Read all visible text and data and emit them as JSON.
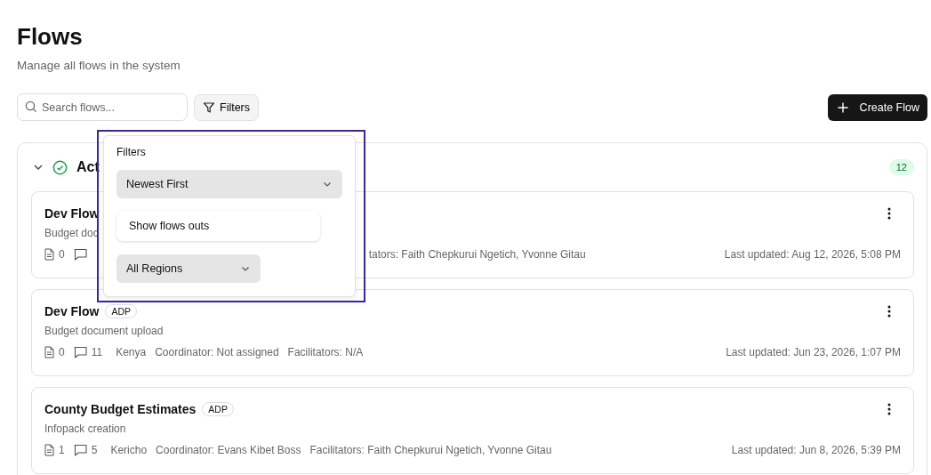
{
  "page": {
    "title": "Flows",
    "subtitle": "Manage all flows in the system"
  },
  "toolbar": {
    "search": {
      "placeholder": "Search flows..."
    },
    "filters_button": "Filters",
    "create_button": "Create Flow"
  },
  "filters_popover": {
    "title": "Filters",
    "sort_select": "Newest First",
    "toggle_row": "Show flows outs",
    "region_select": "All Regions"
  },
  "section": {
    "title": "Act",
    "expanded": true,
    "count": "12"
  },
  "flows": [
    {
      "title": "Dev Flow",
      "description": "Budget doc",
      "documents": "0",
      "facilitators": "tators: Faith Chepkurui Ngetich, Yvonne Gitau",
      "updated": "Last updated: Aug 12, 2026, 5:08 PM"
    },
    {
      "title": "Dev Flow",
      "tag": "ADP",
      "description": "Budget document upload",
      "documents": "0",
      "comments": "11",
      "region": "Kenya",
      "coordinator": "Coordinator: Not assigned",
      "facilitators": "Facilitators: N/A",
      "updated": "Last updated: Jun 23, 2026, 1:07 PM"
    },
    {
      "title": "County Budget Estimates",
      "tag": "ADP",
      "description": "Infopack creation",
      "documents": "1",
      "comments": "5",
      "region": "Kericho",
      "coordinator": "Coordinator: Evans Kibet Boss",
      "facilitators": "Facilitators: Faith Chepkurui Ngetich, Yvonne Gitau",
      "updated": "Last updated: Jun 8, 2026, 5:39 PM"
    }
  ]
}
